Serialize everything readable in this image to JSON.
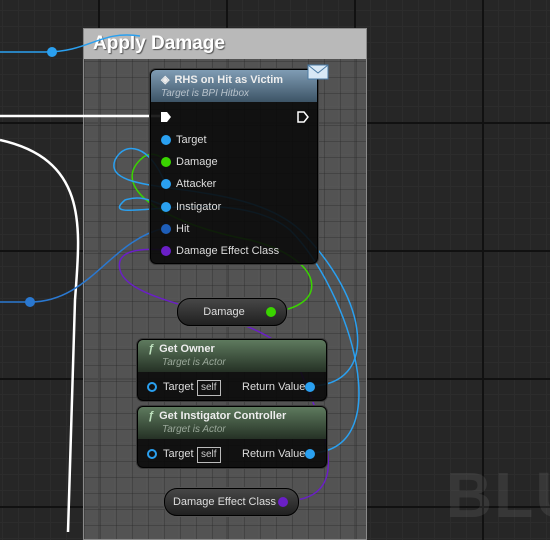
{
  "comment": {
    "title": "Apply Damage"
  },
  "watermark": "BLU",
  "event_node": {
    "title": "RHS on Hit as Victim",
    "subtitle": "Target is BPI Hitbox",
    "icon": "message-envelope-icon",
    "pins": [
      {
        "label": "Target",
        "type": "object",
        "color": "#2aa0f0"
      },
      {
        "label": "Damage",
        "type": "float",
        "color": "#3ad400"
      },
      {
        "label": "Attacker",
        "type": "object",
        "color": "#2aa0f0"
      },
      {
        "label": "Instigator",
        "type": "object",
        "color": "#2aa0f0"
      },
      {
        "label": "Hit",
        "type": "struct",
        "color": "#1e5eb8"
      },
      {
        "label": "Damage Effect Class",
        "type": "class",
        "color": "#6a1fc7"
      }
    ]
  },
  "damage_var": {
    "label": "Damage",
    "color": "#3ad400"
  },
  "get_owner": {
    "title": "Get Owner",
    "subtitle": "Target is Actor",
    "target_label": "Target",
    "target_default": "self",
    "return_label": "Return Value"
  },
  "get_instigator_controller": {
    "title": "Get Instigator Controller",
    "subtitle": "Target is Actor",
    "target_label": "Target",
    "target_default": "self",
    "return_label": "Return Value"
  },
  "effect_class_var": {
    "label": "Damage Effect Class",
    "color": "#6a1fc7"
  },
  "colors": {
    "exec": "#ffffff",
    "object": "#2aa0f0",
    "float": "#3ad400",
    "class": "#6a1fc7",
    "struct": "#1e5eb8"
  }
}
